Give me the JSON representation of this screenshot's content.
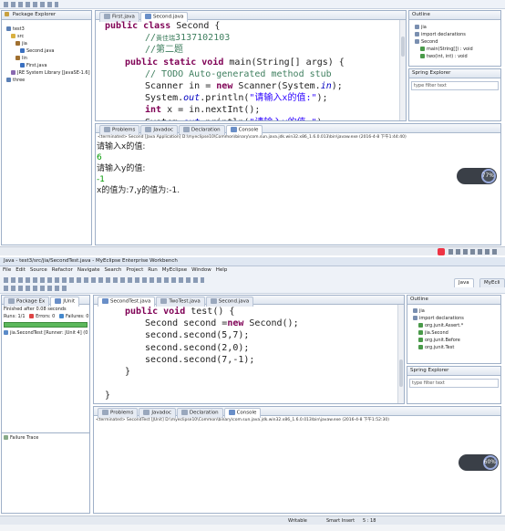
{
  "top": {
    "package_explorer": {
      "title": "Package Explorer",
      "tree": [
        {
          "label": "test3",
          "indent": 1,
          "icon": "project-icon"
        },
        {
          "label": "src",
          "indent": 2,
          "icon": "folder-icon"
        },
        {
          "label": "jia",
          "indent": 3,
          "icon": "package-icon"
        },
        {
          "label": "Second.java",
          "indent": 4,
          "icon": "java-file-icon"
        },
        {
          "label": "lin",
          "indent": 3,
          "icon": "package-icon"
        },
        {
          "label": "First.java",
          "indent": 4,
          "icon": "java-file-icon"
        },
        {
          "label": "JRE System Library [JavaSE-1.6]",
          "indent": 2,
          "icon": "library-icon"
        },
        {
          "label": "three",
          "indent": 1,
          "icon": "project-icon"
        }
      ]
    },
    "editor_tabs": [
      "First.java",
      "Second.java"
    ],
    "active_tab": 1,
    "code": [
      {
        "indent": 0,
        "parts": [
          [
            "kw",
            "public class "
          ],
          [
            "n",
            "Second {"
          ]
        ]
      },
      {
        "indent": 2,
        "parts": [
          [
            "cm",
            "//"
          ],
          [
            "hl",
            "黄佳瑞"
          ],
          [
            "cm",
            "3137102103"
          ]
        ]
      },
      {
        "indent": 2,
        "parts": [
          [
            "cm",
            "//第二题"
          ]
        ]
      },
      {
        "indent": 1,
        "parts": [
          [
            "kw",
            "public static void "
          ],
          [
            "n",
            "main(String[] args) {"
          ]
        ]
      },
      {
        "indent": 2,
        "parts": [
          [
            "cm",
            "// TODO Auto-generated method stub"
          ]
        ]
      },
      {
        "indent": 2,
        "parts": [
          [
            "n",
            "Scanner in = "
          ],
          [
            "kw",
            "new "
          ],
          [
            "n",
            "Scanner(System."
          ],
          [
            "fld",
            "in"
          ],
          [
            "n",
            ");"
          ]
        ]
      },
      {
        "indent": 2,
        "parts": [
          [
            "n",
            "System."
          ],
          [
            "fld",
            "out"
          ],
          [
            "n",
            ".println("
          ],
          [
            "str",
            "\"请输入x的值:\""
          ],
          [
            "n",
            ");"
          ]
        ]
      },
      {
        "indent": 2,
        "parts": [
          [
            "kw",
            "int "
          ],
          [
            "n",
            "x = in.nextInt();"
          ]
        ]
      },
      {
        "indent": 2,
        "parts": [
          [
            "n",
            "System."
          ],
          [
            "fld",
            "out"
          ],
          [
            "n",
            ".println("
          ],
          [
            "str",
            "\"请输入y的值:\""
          ],
          [
            "n",
            ");"
          ]
        ]
      }
    ],
    "console_tabs": [
      "Problems",
      "Javadoc",
      "Declaration",
      "Console"
    ],
    "console_active": 3,
    "console_status": "<terminated> Second [Java Application] D:\\myeclipse10\\Common\\binary\\com.sun.java.jdk.win32.x86_1.6.0.013\\bin\\javaw.exe (2016-4-8 下午1:44:40)",
    "console_lines": [
      {
        "text": "请输入x的值:",
        "color": "black"
      },
      {
        "text": "6",
        "color": "green"
      },
      {
        "text": "请输入y的值:",
        "color": "black"
      },
      {
        "text": "-1",
        "color": "green"
      },
      {
        "text": "x的值为:7,y的值为:-1.",
        "color": "black"
      }
    ],
    "outline": {
      "title": "Outline",
      "items": [
        {
          "label": "jia",
          "indent": 1
        },
        {
          "label": "import declarations",
          "indent": 1
        },
        {
          "label": "Second",
          "indent": 1
        },
        {
          "label": "main(String[]) : void",
          "indent": 2
        },
        {
          "label": "two(int, int) : void",
          "indent": 2
        }
      ]
    },
    "spring": {
      "title": "Spring Explorer",
      "filter": "type filter text"
    },
    "cpu_badge": "77%"
  },
  "bottom": {
    "title_bar": "Java - test3/src/jia/SecondTest.java - MyEclipse Enterprise Workbench",
    "menu": [
      "File",
      "Edit",
      "Source",
      "Refactor",
      "Navigate",
      "Search",
      "Project",
      "Run",
      "MyEclipse",
      "Window",
      "Help"
    ],
    "perspectives": [
      "Java",
      "MyEcli"
    ],
    "left_tabs": [
      "Package Ex",
      "JUnit"
    ],
    "junit": {
      "finished": "Finished after 0.08 seconds",
      "runs": "Runs:  1/1",
      "errors": "Errors:  0",
      "failures": "Failures:  0",
      "test_item": "jia.SecondTest [Runner: JUnit 4] (0",
      "failure_trace": "Failure Trace"
    },
    "editor_tabs": [
      "SecondTest.java",
      "TwoTest.java",
      "Second.java"
    ],
    "active_tab": 0,
    "code": [
      {
        "indent": 1,
        "parts": [
          [
            "kw",
            "public void "
          ],
          [
            "n",
            "test() {"
          ]
        ]
      },
      {
        "indent": 2,
        "parts": [
          [
            "n",
            "Second second ="
          ],
          [
            "kw",
            "new "
          ],
          [
            "n",
            "Second();"
          ]
        ]
      },
      {
        "indent": 2,
        "parts": [
          [
            "n",
            "second.second(5,7);"
          ]
        ]
      },
      {
        "indent": 2,
        "parts": [
          [
            "n",
            "second.second(2,0);"
          ]
        ]
      },
      {
        "indent": 2,
        "parts": [
          [
            "n",
            "second.second(7,-1);"
          ]
        ]
      },
      {
        "indent": 1,
        "parts": [
          [
            "n",
            "}"
          ]
        ]
      },
      {
        "indent": 0,
        "parts": [
          [
            "n",
            ""
          ]
        ]
      },
      {
        "indent": 0,
        "parts": [
          [
            "n",
            "}"
          ]
        ]
      }
    ],
    "console_tabs": [
      "Problems",
      "Javadoc",
      "Declaration",
      "Console"
    ],
    "console_active": 3,
    "console_status": "<terminated> SecondTest [JUnit] D:\\myeclipse10\\Common\\binary\\com.sun.java.jdk.win32.x86_1.6.0.013\\bin\\javaw.exe (2016-4-8 下午1:52:30)",
    "outline": {
      "title": "Outline",
      "items": [
        {
          "label": "jia",
          "indent": 1
        },
        {
          "label": "import declarations",
          "indent": 1
        },
        {
          "label": "org.junit.Assert.*",
          "indent": 2
        },
        {
          "label": "jia.Second",
          "indent": 2
        },
        {
          "label": "org.junit.Before",
          "indent": 2
        },
        {
          "label": "org.junit.Test",
          "indent": 2
        }
      ]
    },
    "spring": {
      "title": "Spring Explorer",
      "filter": "type filter text"
    },
    "status": {
      "writable": "Writable",
      "insert": "Smart Insert",
      "position": "5 : 18"
    },
    "cpu_badge": "60%"
  },
  "colors": {
    "keyword": "#7f0055",
    "comment": "#3f7f5f",
    "string": "#2a00ff",
    "console_input": "#009900",
    "junit_bar": "#5cb85c",
    "taskbar": "#1f3a6e"
  }
}
